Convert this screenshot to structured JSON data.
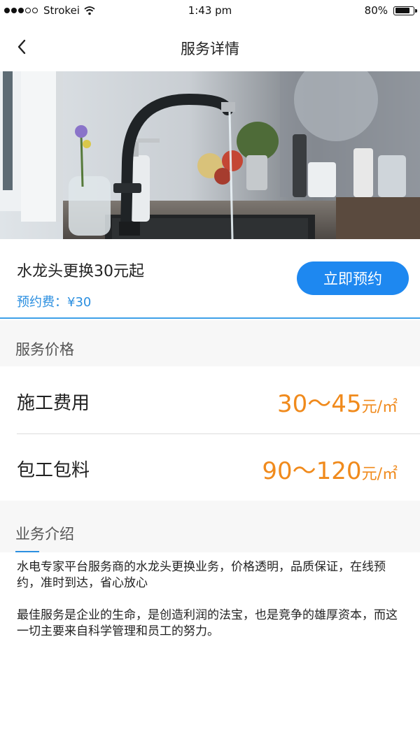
{
  "status_bar": {
    "carrier": "Strokei",
    "time": "1:43 pm",
    "battery_percent": "80%",
    "battery_level": 0.8,
    "signal_icon": "signal-dots-icon",
    "wifi_icon": "wifi-icon"
  },
  "nav": {
    "title": "服务详情",
    "back_icon": "chevron-left-icon"
  },
  "hero": {
    "image": "kitchen-faucet-photo"
  },
  "service": {
    "name": "水龙头更换30元起",
    "fee": "预约费：¥30",
    "book_label": "立即预约",
    "accent_color": "#1e88f0"
  },
  "pricing": {
    "section_title": "服务价格",
    "items": [
      {
        "label": "施工费用",
        "range": "30～45",
        "unit": "元/㎡"
      },
      {
        "label": "包工包料",
        "range": "90～120",
        "unit": "元/㎡"
      }
    ],
    "price_color": "#f08a1c"
  },
  "intro": {
    "section_title": "业务介绍",
    "paragraphs": [
      "水电专家平台服务商的水龙头更换业务，价格透明，品质保证，在线预约，准时到达，省心放心",
      "最佳服务是企业的生命，是创造利润的法宝，也是竞争的雄厚资本，而这一切主要来自科学管理和员工的努力。"
    ]
  }
}
